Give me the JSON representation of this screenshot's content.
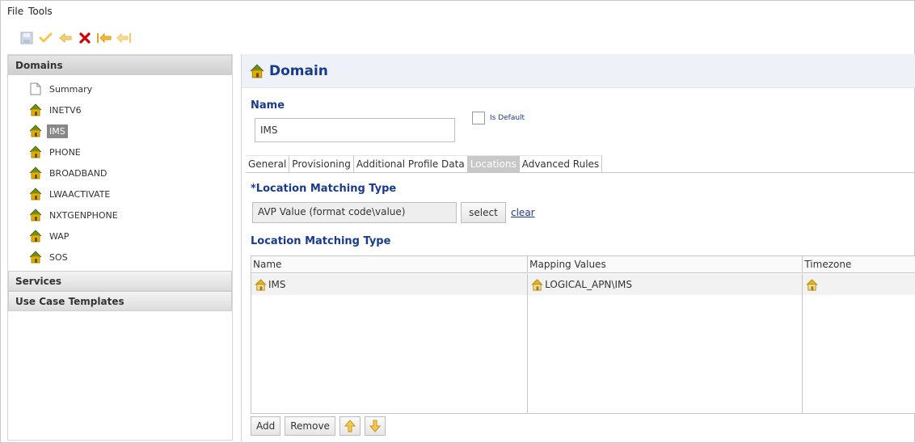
{
  "menu": {
    "file": "File",
    "tools": "Tools"
  },
  "toolbar": {
    "icons": [
      "save-icon",
      "check-icon",
      "undo-icon",
      "delete-icon",
      "move-first-icon",
      "move-last-icon"
    ]
  },
  "sidebar": {
    "sections": [
      {
        "label": "Domains"
      },
      {
        "label": "Services"
      },
      {
        "label": "Use Case Templates"
      }
    ],
    "items": [
      {
        "label": "Summary",
        "icon": "document-icon"
      },
      {
        "label": "INETV6",
        "icon": "house-icon"
      },
      {
        "label": "IMS",
        "icon": "house-icon",
        "selected": true
      },
      {
        "label": "PHONE",
        "icon": "house-icon"
      },
      {
        "label": "BROADBAND",
        "icon": "house-icon"
      },
      {
        "label": "LWAACTIVATE",
        "icon": "house-icon"
      },
      {
        "label": "NXTGENPHONE",
        "icon": "house-icon"
      },
      {
        "label": "WAP",
        "icon": "house-icon"
      },
      {
        "label": "SOS",
        "icon": "house-icon"
      }
    ]
  },
  "main": {
    "title": "Domain",
    "name_label": "Name",
    "name_value": "IMS",
    "is_default_label": "Is Default",
    "tabs": [
      {
        "label": "General"
      },
      {
        "label": "Provisioning"
      },
      {
        "label": "Additional Profile Data"
      },
      {
        "label": "Locations",
        "active": true
      },
      {
        "label": "Advanced Rules"
      }
    ],
    "location_matching_type_label": "*Location Matching Type",
    "location_matching_type_value": "AVP Value (format code\\value)",
    "select_label": "select",
    "clear_label": "clear",
    "location_table_label": "Location Matching Type",
    "table": {
      "columns": [
        "Name",
        "Mapping Values",
        "Timezone"
      ],
      "rows": [
        {
          "name": "IMS",
          "mapping": "LOGICAL_APN\\IMS",
          "timezone": ""
        }
      ]
    },
    "buttons": {
      "add": "Add",
      "remove": "Remove"
    }
  },
  "colors": {
    "accent": "#1a3a8c",
    "house_roof": "#6b8e23",
    "house_body": "#e0b100",
    "delete": "#d00000"
  }
}
